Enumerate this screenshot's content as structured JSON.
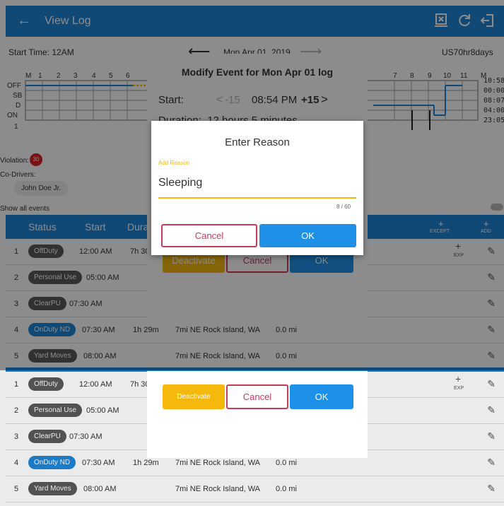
{
  "appbar": {
    "title": "View Log"
  },
  "log": {
    "start_time": "Start Time: 12AM",
    "date": "Mon Apr 01, 2019",
    "cycle": "US70hr8days",
    "rows": [
      "OFF",
      "SB",
      "D",
      "ON"
    ],
    "totals": [
      "10:58",
      "00:00",
      "08:07",
      "04:00",
      "23:05"
    ],
    "hour_labels": [
      "M",
      "1",
      "2",
      "3",
      "4",
      "5",
      "6",
      "7",
      "8",
      "9",
      "10",
      "11",
      "M"
    ]
  },
  "violation": {
    "label": "Violation:",
    "count": "30"
  },
  "co_drivers": {
    "label": "Co-Drivers:",
    "name": "John Doe Jr."
  },
  "show_all": "Show all events",
  "table": {
    "headers": [
      "Status",
      "Start",
      "Dura"
    ],
    "except": "EXCEPT",
    "add": "ADD",
    "exp": "EXP",
    "rows": [
      {
        "num": "1",
        "status": "OffDuty",
        "start": "12:00 AM",
        "dur": "7h 30",
        "loc": "",
        "dist": ""
      },
      {
        "num": "2",
        "status": "Personal Use",
        "start": "05:00 AM",
        "dur": "",
        "loc": "",
        "dist": ""
      },
      {
        "num": "3",
        "status": "ClearPU",
        "start": "07:30 AM",
        "dur": "",
        "loc": "",
        "dist": ""
      },
      {
        "num": "4",
        "status": "OnDuty ND",
        "start": "07:30 AM",
        "dur": "1h 29m",
        "loc": "7mi NE Rock Island, WA",
        "dist": "0.0 mi"
      },
      {
        "num": "5",
        "status": "Yard Moves",
        "start": "08:00 AM",
        "dur": "",
        "loc": "7mi NE Rock Island, WA",
        "dist": "0.0 mi"
      }
    ]
  },
  "modify": {
    "title": "Modify Event for Mon Apr 01 log",
    "start_label": "Start:",
    "minus": "-15",
    "time": "08:54 PM",
    "plus": "+15",
    "duration": "Duration:  12 hours 5 minutes",
    "deactivate": "Deactivate",
    "cancel": "Cancel",
    "ok": "OK"
  },
  "reason": {
    "title": "Enter Reason",
    "field_label": "Add Reason",
    "value": "Sleeping",
    "counter": "8 / 60",
    "cancel": "Cancel",
    "ok": "OK"
  },
  "colors": {
    "primary": "#1e86d8",
    "accent": "#f5b80c",
    "danger": "#c43b5e"
  }
}
